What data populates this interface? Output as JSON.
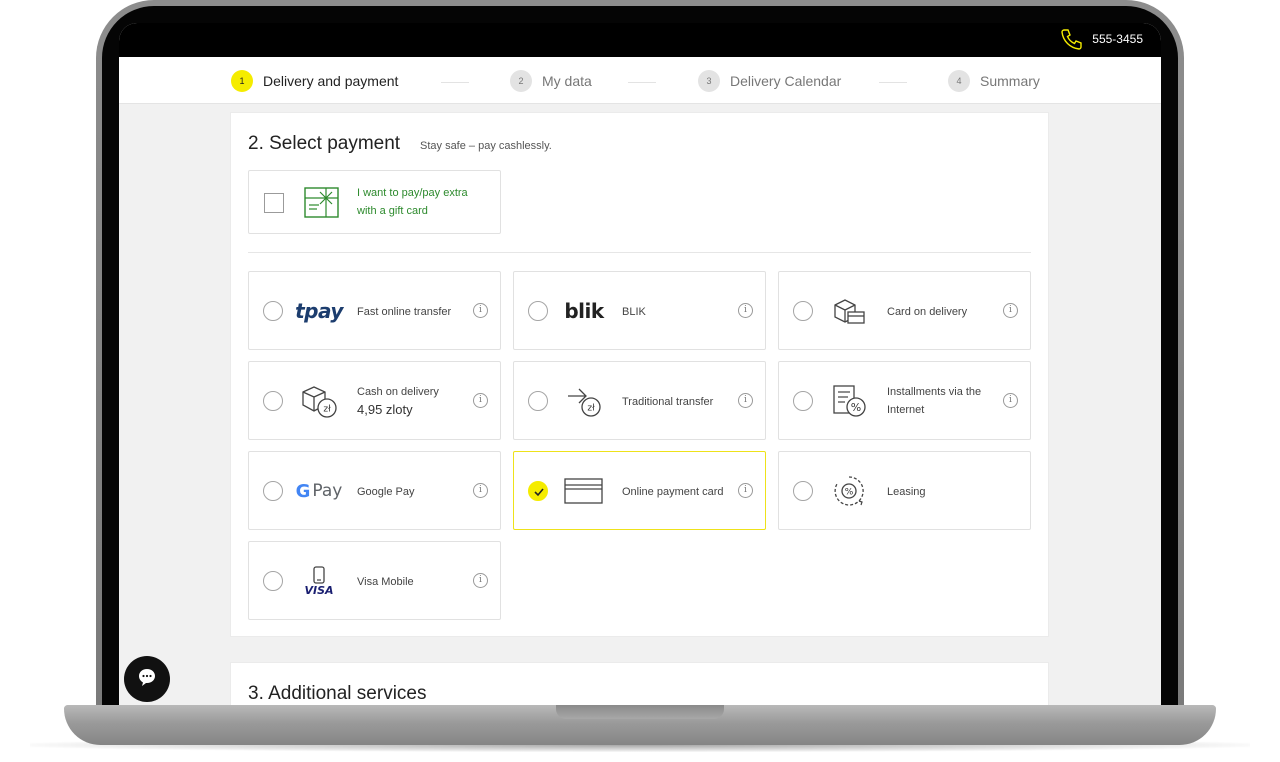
{
  "header": {
    "phone": "555-3455"
  },
  "steps": [
    {
      "num": "1",
      "label": "Delivery and payment",
      "active": true
    },
    {
      "num": "2",
      "label": "My data",
      "active": false
    },
    {
      "num": "3",
      "label": "Delivery Calendar",
      "active": false
    },
    {
      "num": "4",
      "label": "Summary",
      "active": false
    }
  ],
  "payment": {
    "title": "2. Select payment",
    "subtitle": "Stay safe – pay cashlessly.",
    "gift_card": {
      "label": "I want to pay/pay extra with a gift card",
      "checked": false,
      "color": "#2d8a2d"
    },
    "options": [
      {
        "id": "tpay",
        "label": "Fast online transfer",
        "logo_text": "tpay",
        "selected": false
      },
      {
        "id": "blik",
        "label": "BLIK",
        "logo_text": "blik",
        "selected": false
      },
      {
        "id": "card-delivery",
        "label": "Card on delivery",
        "selected": false
      },
      {
        "id": "cash-delivery",
        "label": "Cash on delivery",
        "sublabel": "4,95 zloty",
        "selected": false
      },
      {
        "id": "traditional",
        "label": "Traditional transfer",
        "selected": false
      },
      {
        "id": "installments",
        "label": "Installments via the Internet",
        "selected": false
      },
      {
        "id": "gpay",
        "label": "Google Pay",
        "logo_text": "Pay",
        "selected": false
      },
      {
        "id": "online-card",
        "label": "Online payment card",
        "selected": true
      },
      {
        "id": "leasing",
        "label": "Leasing",
        "selected": false
      },
      {
        "id": "visa-mobile",
        "label": "Visa Mobile",
        "logo_text": "VISA",
        "selected": false
      }
    ],
    "info_glyph": "i"
  },
  "additional": {
    "title": "3. Additional services"
  },
  "colors": {
    "accent": "#f5ec00",
    "topbar": "#000000",
    "gift_green": "#2d8a2d"
  }
}
